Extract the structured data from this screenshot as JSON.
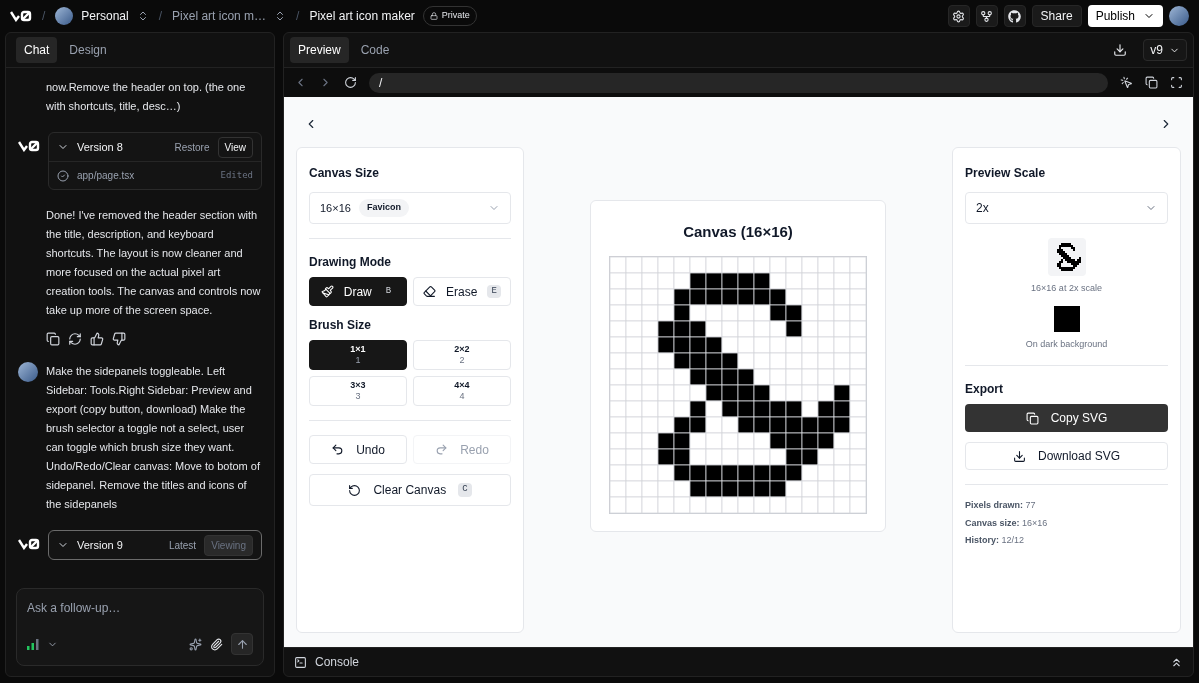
{
  "topbar": {
    "separator": "/",
    "workspace": "Personal",
    "project": "Pixel art icon m…",
    "title": "Pixel art icon maker",
    "badge": "Private",
    "share": "Share",
    "publish": "Publish"
  },
  "chat": {
    "tabs": [
      {
        "label": "Chat",
        "selected": true
      },
      {
        "label": "Design",
        "selected": false
      }
    ],
    "messages": [
      {
        "kind": "user_cont",
        "text": "now.Remove the header on top. (the one with shortcuts, title, desc…)"
      },
      {
        "kind": "version",
        "title": "Version 8",
        "status": "Restore",
        "action": "View",
        "viewing": false,
        "file": "app/page.tsx",
        "file_status": "Edited"
      },
      {
        "kind": "assistant",
        "text": "Done! I've removed the header section with the title, description, and keyboard shortcuts. The layout is now cleaner and more focused on the actual pixel art creation tools. The canvas and controls now take up more of the screen space."
      },
      {
        "kind": "user",
        "text": "Make the sidepanels toggleable. Left Sidebar: Tools.Right Sidebar: Preview and export (copy button, download) Make the brush selector a toggle not a select, user can toggle which brush size they want. Undo/Redo/Clear canvas: Move to botom of sidepanel. Remove the titles and icons of the sidepanels"
      },
      {
        "kind": "version",
        "title": "Version 9",
        "status": "Latest",
        "action": "Viewing",
        "viewing": true
      }
    ],
    "input": {
      "placeholder": "Ask a follow-up…"
    }
  },
  "preview": {
    "tabs": [
      {
        "label": "Preview",
        "selected": true
      },
      {
        "label": "Code",
        "selected": false
      }
    ],
    "version": "v9",
    "url": "/",
    "console": "Console"
  },
  "tools": {
    "canvas_size": {
      "label": "Canvas Size",
      "value": "16×16",
      "tag": "Favicon"
    },
    "drawing_mode": {
      "label": "Drawing Mode",
      "modes": [
        {
          "kind": "draw",
          "label": "Draw",
          "key": "B",
          "selected": true
        },
        {
          "kind": "erase",
          "label": "Erase",
          "key": "E",
          "selected": false
        }
      ]
    },
    "brush_size": {
      "label": "Brush Size",
      "sizes": [
        {
          "label": "1×1",
          "hint": "1",
          "selected": true
        },
        {
          "label": "2×2",
          "hint": "2",
          "selected": false
        },
        {
          "label": "3×3",
          "hint": "3",
          "selected": false
        },
        {
          "label": "4×4",
          "hint": "4",
          "selected": false
        }
      ]
    },
    "undo": {
      "label": "Undo",
      "disabled": false
    },
    "redo": {
      "label": "Redo",
      "disabled": true
    },
    "clear": {
      "label": "Clear Canvas",
      "key": "C"
    }
  },
  "canvas": {
    "title": "Canvas (16×16)",
    "pixels": [
      [
        false,
        false,
        false,
        false,
        false,
        false,
        false,
        false,
        false,
        false,
        false,
        false,
        false,
        false,
        false,
        false
      ],
      [
        false,
        false,
        false,
        false,
        false,
        true,
        true,
        true,
        true,
        true,
        false,
        false,
        false,
        false,
        false,
        false
      ],
      [
        false,
        false,
        false,
        false,
        true,
        true,
        true,
        true,
        true,
        true,
        true,
        false,
        false,
        false,
        false,
        false
      ],
      [
        false,
        false,
        false,
        false,
        true,
        false,
        false,
        false,
        false,
        false,
        true,
        true,
        false,
        false,
        false,
        false
      ],
      [
        false,
        false,
        false,
        true,
        true,
        true,
        false,
        false,
        false,
        false,
        false,
        true,
        false,
        false,
        false,
        false
      ],
      [
        false,
        false,
        false,
        true,
        true,
        true,
        true,
        false,
        false,
        false,
        false,
        false,
        false,
        false,
        false,
        false
      ],
      [
        false,
        false,
        false,
        false,
        true,
        true,
        true,
        true,
        false,
        false,
        false,
        false,
        false,
        false,
        false,
        false
      ],
      [
        false,
        false,
        false,
        false,
        false,
        true,
        true,
        true,
        true,
        false,
        false,
        false,
        false,
        false,
        false,
        false
      ],
      [
        false,
        false,
        false,
        false,
        false,
        false,
        true,
        true,
        true,
        true,
        false,
        false,
        false,
        false,
        true,
        false
      ],
      [
        false,
        false,
        false,
        false,
        false,
        true,
        false,
        true,
        true,
        true,
        true,
        true,
        false,
        true,
        true,
        false
      ],
      [
        false,
        false,
        false,
        false,
        true,
        true,
        false,
        false,
        true,
        true,
        true,
        true,
        true,
        true,
        true,
        false
      ],
      [
        false,
        false,
        false,
        true,
        true,
        false,
        false,
        false,
        false,
        false,
        true,
        true,
        true,
        true,
        false,
        false
      ],
      [
        false,
        false,
        false,
        true,
        true,
        false,
        false,
        false,
        false,
        false,
        false,
        true,
        true,
        false,
        false,
        false
      ],
      [
        false,
        false,
        false,
        false,
        true,
        true,
        true,
        true,
        true,
        true,
        true,
        true,
        false,
        false,
        false,
        false
      ],
      [
        false,
        false,
        false,
        false,
        false,
        true,
        true,
        true,
        true,
        true,
        true,
        false,
        false,
        false,
        false,
        false
      ],
      [
        false,
        false,
        false,
        false,
        false,
        false,
        false,
        false,
        false,
        false,
        false,
        false,
        false,
        false,
        false,
        false
      ]
    ]
  },
  "export": {
    "scale_label": "Preview Scale",
    "scale": "2x",
    "scale_caption": "16×16 at 2x scale",
    "dark_caption": "On dark background",
    "label": "Export",
    "copy": "Copy SVG",
    "download": "Download SVG",
    "stats": [
      {
        "label": "Pixels drawn:",
        "value": "77"
      },
      {
        "label": "Canvas size:",
        "value": "16×16"
      },
      {
        "label": "History:",
        "value": "12/12"
      }
    ]
  }
}
